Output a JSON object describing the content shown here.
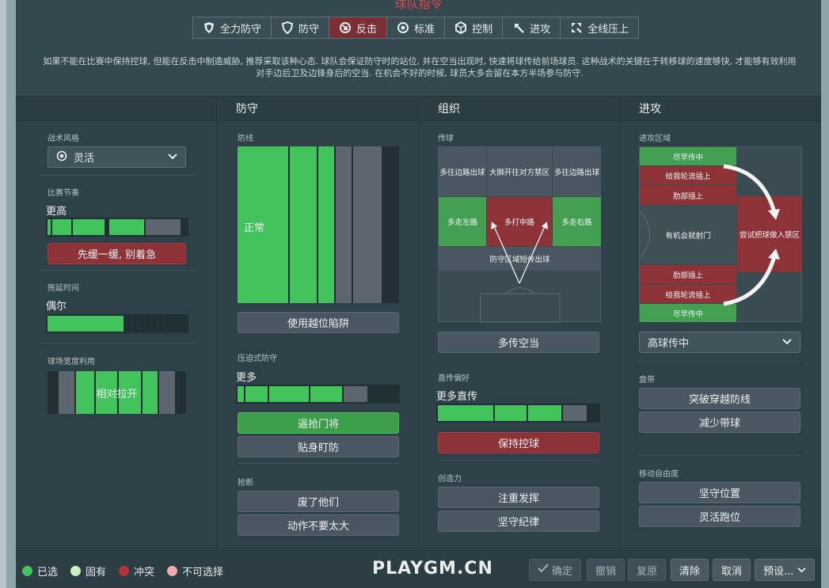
{
  "title": "球队指令",
  "tabs": [
    {
      "label": "全力防守",
      "icon": "shield-double-icon"
    },
    {
      "label": "防守",
      "icon": "shield-icon"
    },
    {
      "label": "反击",
      "icon": "counter-icon",
      "active": true
    },
    {
      "label": "标准",
      "icon": "target-icon"
    },
    {
      "label": "控制",
      "icon": "cube-icon"
    },
    {
      "label": "进攻",
      "icon": "arrow-up-left-icon"
    },
    {
      "label": "全线压上",
      "icon": "arrows-icon"
    }
  ],
  "description": "如果不能在比赛中保持控球, 但能在反击中制造威胁, 推荐采取该种心态. 球队会保证防守时的站位, 并在空当出现时, 快速将球传给前场球员. 这种战术的关键在于转移球的速度够快, 才能够有效利用对手边后卫及边锋身后的空当. 在机会不好的时候, 球员大多会留在本方半场参与防守.",
  "left": {
    "style_label": "战术风格",
    "style_value": "灵活",
    "tempo_label": "比赛节奏",
    "tempo_value": "更高",
    "tempo_button": "先缓一缓, 别着急",
    "tempo_level": 0.72,
    "timewasting_label": "拖延时间",
    "timewasting_value": "偶尔",
    "timewasting_level": 0.55,
    "width_label": "球场宽度利用",
    "width_value": "相对拉开"
  },
  "defense": {
    "header": "防守",
    "line_label": "防线",
    "line_value": "正常",
    "offside_button": "使用越位陷阱",
    "press_label": "压迫式防守",
    "press_value": "更多",
    "press_level": 0.72,
    "press_buttons": [
      "逼抢门将",
      "贴身盯防"
    ],
    "tackle_label": "抢断",
    "tackle_buttons": [
      "废了他们",
      "动作不要太大"
    ]
  },
  "organize": {
    "header": "组织",
    "pass_label": "传球",
    "zones": {
      "left_wide": "多往边路出球",
      "long_ball": "大脚开往对方禁区",
      "right_wide": "多往边路出球",
      "left": "多走左路",
      "center": "多打中路",
      "right": "多走右路",
      "short": "防守区域短传出球"
    },
    "space_button": "多传空当",
    "directness_label": "直传偏好",
    "directness_value": "更多直传",
    "directness_level": 0.7,
    "possession_button": "保持控球",
    "creativity_label": "创造力",
    "creativity_buttons": [
      "注重发挥",
      "坚守纪律"
    ]
  },
  "attack": {
    "header": "进攻",
    "zone_label": "进攻区域",
    "zones": {
      "cross_early_top": "尽早传中",
      "overlap_top": "给我轮流插上",
      "underlap_top": "肋部插上",
      "shoot": "有机会就射门",
      "work_in": "尝试把球做入禁区",
      "underlap_bottom": "肋部插上",
      "overlap_bottom": "给我轮流插上",
      "cross_early_bottom": "尽早传中"
    },
    "cross_select": "高球传中",
    "dribble_label": "盘带",
    "dribble_buttons": [
      "突破穿越防线",
      "减少带球"
    ],
    "movement_label": "移动自由度",
    "movement_buttons": [
      "坚守位置",
      "灵活跑位"
    ]
  },
  "footer": {
    "legend": [
      {
        "label": "已选",
        "color": "#43c35b"
      },
      {
        "label": "固有",
        "color": "#c9f1c2"
      },
      {
        "label": "冲突",
        "color": "#b83038"
      },
      {
        "label": "不可选择",
        "color": "#f1a9ad"
      }
    ],
    "watermark": "PLAYGM.CN",
    "buttons": {
      "confirm": "确定",
      "undo": "撤销",
      "redo": "复原",
      "clear": "清除",
      "cancel": "取消",
      "preset": "预设..."
    }
  }
}
